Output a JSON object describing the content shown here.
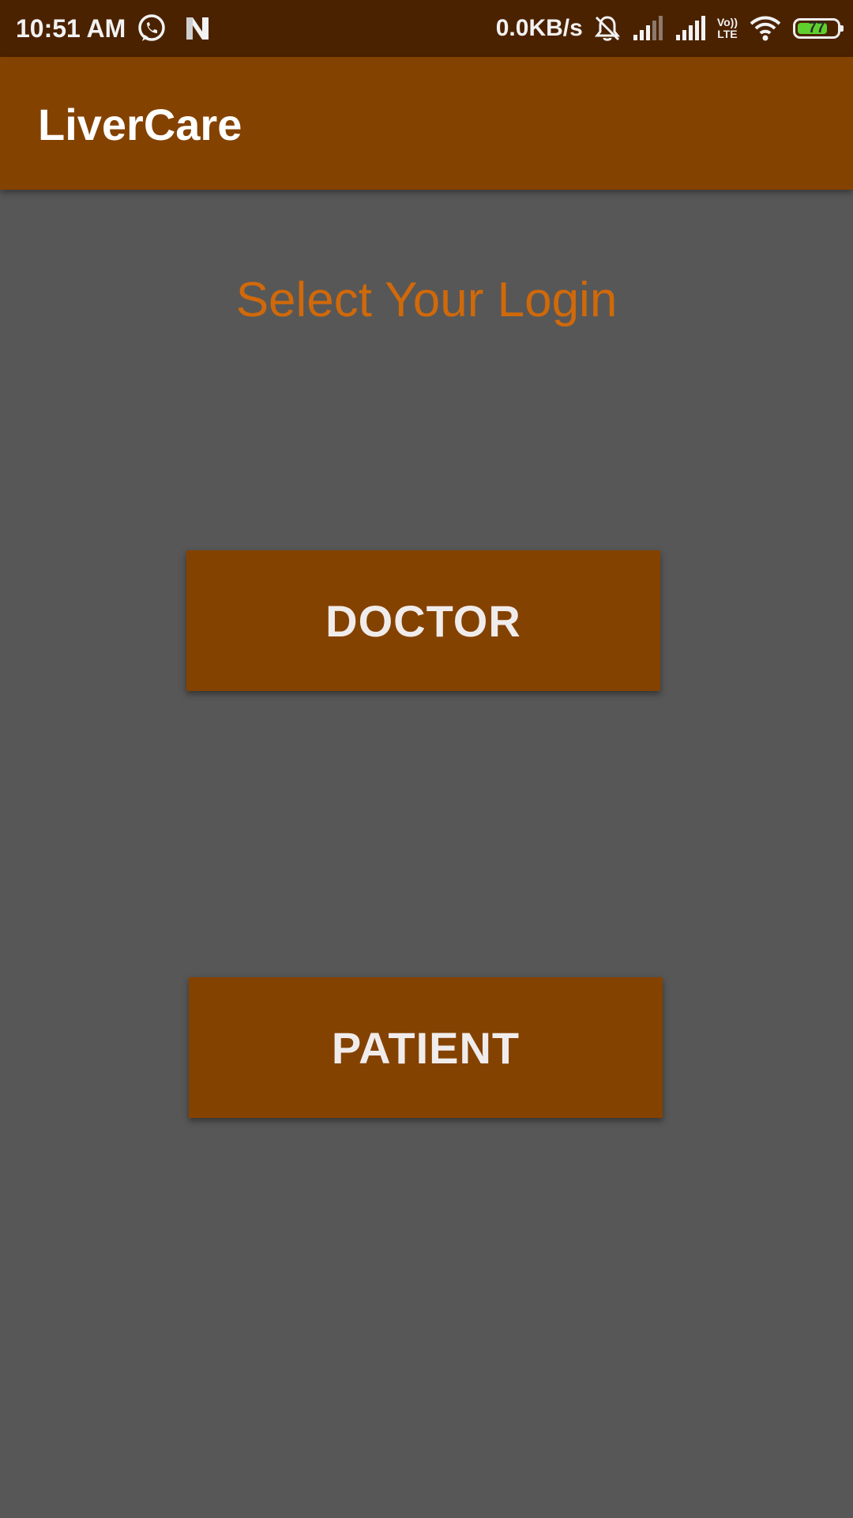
{
  "status_bar": {
    "time": "10:51 AM",
    "net_speed": "0.0KB/s",
    "volte_top": "Vo))",
    "volte_bottom": "LTE",
    "battery_level": "77",
    "battery_fraction": 0.77,
    "icons": [
      "whatsapp-icon",
      "notification-n-icon",
      "bell-off-icon",
      "signal-icon",
      "signal-icon",
      "volte-icon",
      "wifi-icon",
      "battery-icon"
    ]
  },
  "app_bar": {
    "title": "LiverCare"
  },
  "main": {
    "heading": "Select Your Login",
    "doctor_label": "DOCTOR",
    "patient_label": "PATIENT"
  },
  "colors": {
    "status_bar": "#4b2200",
    "app_bar": "#844200",
    "background": "#575757",
    "heading": "#d0690a",
    "button": "#844200",
    "button_text": "#f1ecec",
    "battery_fill": "#5fcf2e"
  }
}
